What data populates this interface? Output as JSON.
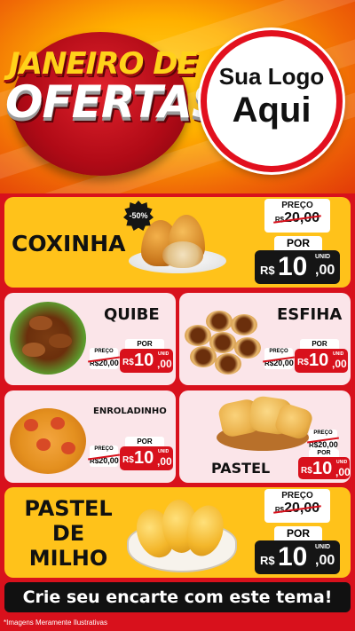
{
  "header": {
    "title_line1": "JANEIRO DE",
    "title_line2": "OFERTAS",
    "logo_line1": "Sua Logo",
    "logo_line2": "Aqui"
  },
  "products": [
    {
      "name": "COXINHA",
      "discount": "-50%",
      "preco_label": "PREÇO",
      "old_currency": "R$",
      "old_price": "20,00",
      "por_label": "POR",
      "currency": "R$",
      "price_int": "10",
      "price_dec": ",00",
      "unit": "UNID"
    },
    {
      "name": "QUIBE",
      "preco_label": "PREÇO",
      "old_currency": "R$",
      "old_price": "20,00",
      "por_label": "POR",
      "currency": "R$",
      "price_int": "10",
      "price_dec": ",00",
      "unit": "UNID"
    },
    {
      "name": "ESFIHA",
      "preco_label": "PREÇO",
      "old_currency": "R$",
      "old_price": "20,00",
      "por_label": "POR",
      "currency": "R$",
      "price_int": "10",
      "price_dec": ",00",
      "unit": "UNID"
    },
    {
      "name": "ENROLADINHO",
      "preco_label": "PREÇO",
      "old_currency": "R$",
      "old_price": "20,00",
      "por_label": "POR",
      "currency": "R$",
      "price_int": "10",
      "price_dec": ",00",
      "unit": "UNID"
    },
    {
      "name": "PASTEL",
      "preco_label": "PREÇO",
      "old_currency": "R$",
      "old_price": "20,00",
      "por_label": "POR",
      "currency": "R$",
      "price_int": "10",
      "price_dec": ",00",
      "unit": "UNID"
    },
    {
      "name_line1": "PASTEL",
      "name_line2": "DE",
      "name_line3": "MILHO",
      "preco_label": "PREÇO",
      "old_currency": "R$",
      "old_price": "20,00",
      "por_label": "POR",
      "currency": "R$",
      "price_int": "10",
      "price_dec": ",00",
      "unit": "UNID"
    }
  ],
  "cta": "Crie seu encarte com este tema!",
  "footnote": "*Imagens Meramente Ilustrativas",
  "colors": {
    "red": "#d8111c",
    "yellow": "#ffc21a",
    "pink": "#fbe5e9",
    "black": "#151515"
  }
}
